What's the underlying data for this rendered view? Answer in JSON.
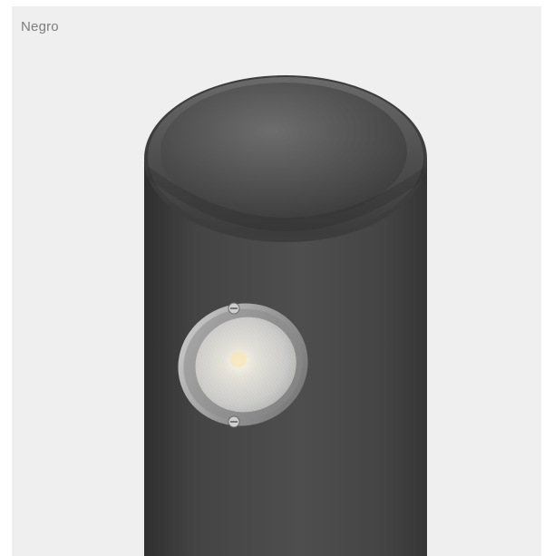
{
  "label": {
    "color_name": "Negro"
  },
  "product": {
    "body_color": "#4a4a4a",
    "background_color": "#efefef"
  }
}
